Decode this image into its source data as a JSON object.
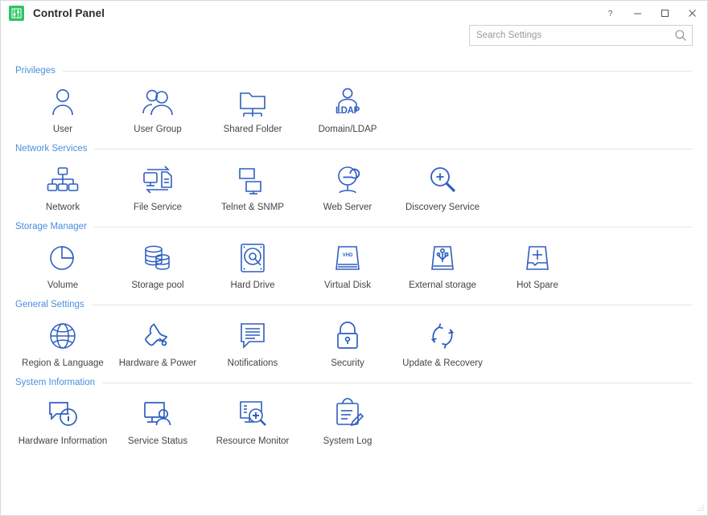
{
  "window": {
    "title": "Control Panel",
    "app_icon": "control-panel-icon",
    "accent_green": "#2ec465",
    "icon_blue": "#2f5fc0",
    "section_blue": "#4a8fdb",
    "label_gray": "#444444",
    "controls": [
      {
        "name": "help",
        "glyph": "?"
      },
      {
        "name": "minimize",
        "glyph": "—"
      },
      {
        "name": "maximize",
        "glyph": "□"
      },
      {
        "name": "close",
        "glyph": "×"
      }
    ]
  },
  "search": {
    "placeholder": "Search Settings",
    "value": "",
    "icon": "search-icon"
  },
  "sections": [
    {
      "title": "Privileges",
      "items": [
        {
          "label": "User",
          "icon": "user-icon"
        },
        {
          "label": "User Group",
          "icon": "user-group-icon"
        },
        {
          "label": "Shared Folder",
          "icon": "shared-folder-icon"
        },
        {
          "label": "Domain/LDAP",
          "icon": "domain-ldap-icon",
          "icon_text": "LDAP"
        }
      ]
    },
    {
      "title": "Network Services",
      "items": [
        {
          "label": "Network",
          "icon": "network-icon"
        },
        {
          "label": "File Service",
          "icon": "file-service-icon"
        },
        {
          "label": "Telnet & SNMP",
          "icon": "telnet-snmp-icon"
        },
        {
          "label": "Web Server",
          "icon": "web-server-icon"
        },
        {
          "label": "Discovery Service",
          "icon": "discovery-service-icon"
        }
      ]
    },
    {
      "title": "Storage Manager",
      "items": [
        {
          "label": "Volume",
          "icon": "volume-icon"
        },
        {
          "label": "Storage pool",
          "icon": "storage-pool-icon"
        },
        {
          "label": "Hard Drive",
          "icon": "hard-drive-icon"
        },
        {
          "label": "Virtual Disk",
          "icon": "virtual-disk-icon",
          "icon_text": "VHD"
        },
        {
          "label": "External storage",
          "icon": "external-storage-icon"
        },
        {
          "label": "Hot Spare",
          "icon": "hot-spare-icon"
        }
      ]
    },
    {
      "title": "General Settings",
      "items": [
        {
          "label": "Region & Language",
          "icon": "globe-icon"
        },
        {
          "label": "Hardware & Power",
          "icon": "wrench-icon"
        },
        {
          "label": "Notifications",
          "icon": "notification-icon"
        },
        {
          "label": "Security",
          "icon": "lock-icon"
        },
        {
          "label": "Update & Recovery",
          "icon": "update-recovery-icon"
        }
      ]
    },
    {
      "title": "System Information",
      "items": [
        {
          "label": "Hardware Information",
          "icon": "hardware-information-icon"
        },
        {
          "label": "Service Status",
          "icon": "service-status-icon"
        },
        {
          "label": "Resource Monitor",
          "icon": "resource-monitor-icon"
        },
        {
          "label": "System Log",
          "icon": "system-log-icon"
        }
      ]
    }
  ]
}
